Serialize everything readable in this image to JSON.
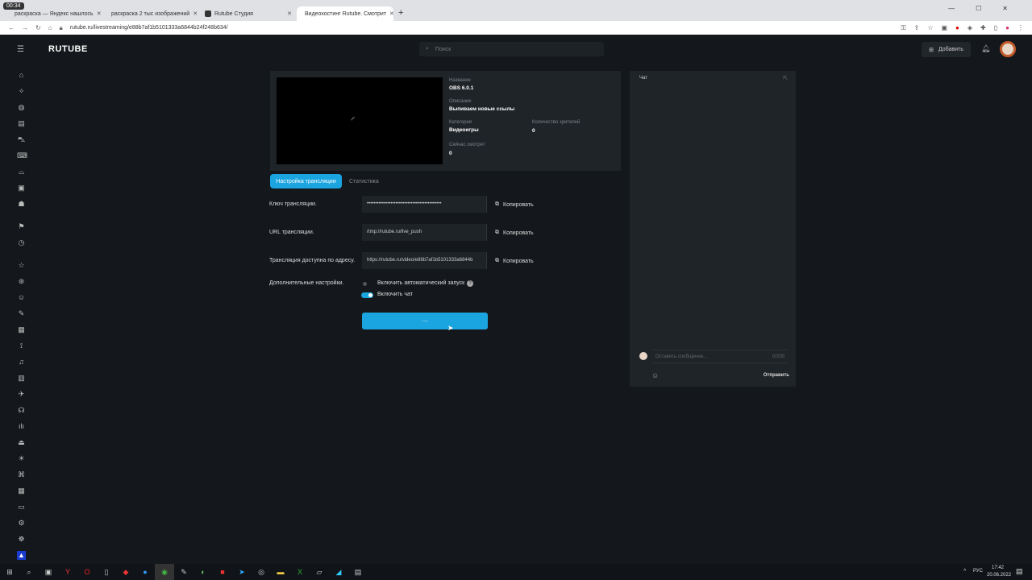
{
  "browser": {
    "tabs": [
      {
        "label": "раскраска — Яндекс нашлось"
      },
      {
        "label": "раскраска 2 тыс изображений"
      },
      {
        "label": "Rutube Студия"
      },
      {
        "label": "Видеохостинг Rutube. Смотрит"
      }
    ],
    "url": "rutube.ru/livestreaming/e88b7af1b5101333a6844b24f248b634/",
    "recording_time": "00:34"
  },
  "header": {
    "logo": "RUTUBE",
    "search_placeholder": "Поиск",
    "add_label": "Добавить"
  },
  "stream": {
    "name_label": "Название",
    "name": "OBS 6.0.1",
    "desc_label": "Описание",
    "desc": "Выпиваем новые ссылы",
    "category_label": "Категория",
    "category": "Видеоигры",
    "comments_label": "Количество зрителей",
    "comments": "0",
    "viewers_label": "Сейчас смотрят",
    "viewers": "0"
  },
  "tabs": {
    "settings": "Настройка трансляции",
    "stats": "Статистика"
  },
  "form": {
    "key_label": "Ключ трансляции.",
    "key_value": "••••••••••••••••••••••••••••••••••••••••••••",
    "url_label": "URL трансляции.",
    "url_value": "rtmp://rutube.ru/live_push",
    "addr_label": "Трансляция доступна по адресу.",
    "addr_value": "https://rutube.ru/video/e88b7af1b5101333a6844b",
    "copy": "Копировать",
    "extra_label": "Дополнительные настройки.",
    "autostart": "Включить автоматический запуск",
    "chat_toggle": "Включить чат",
    "chat_enabled": true,
    "autostart_enabled": false
  },
  "chat": {
    "title": "Чат",
    "placeholder": "Оставить сообщение...",
    "counter": "0/200",
    "send": "Отправить"
  },
  "taskbar": {
    "lang": "РУС",
    "time": "17:42",
    "date": "20.06.2022"
  }
}
